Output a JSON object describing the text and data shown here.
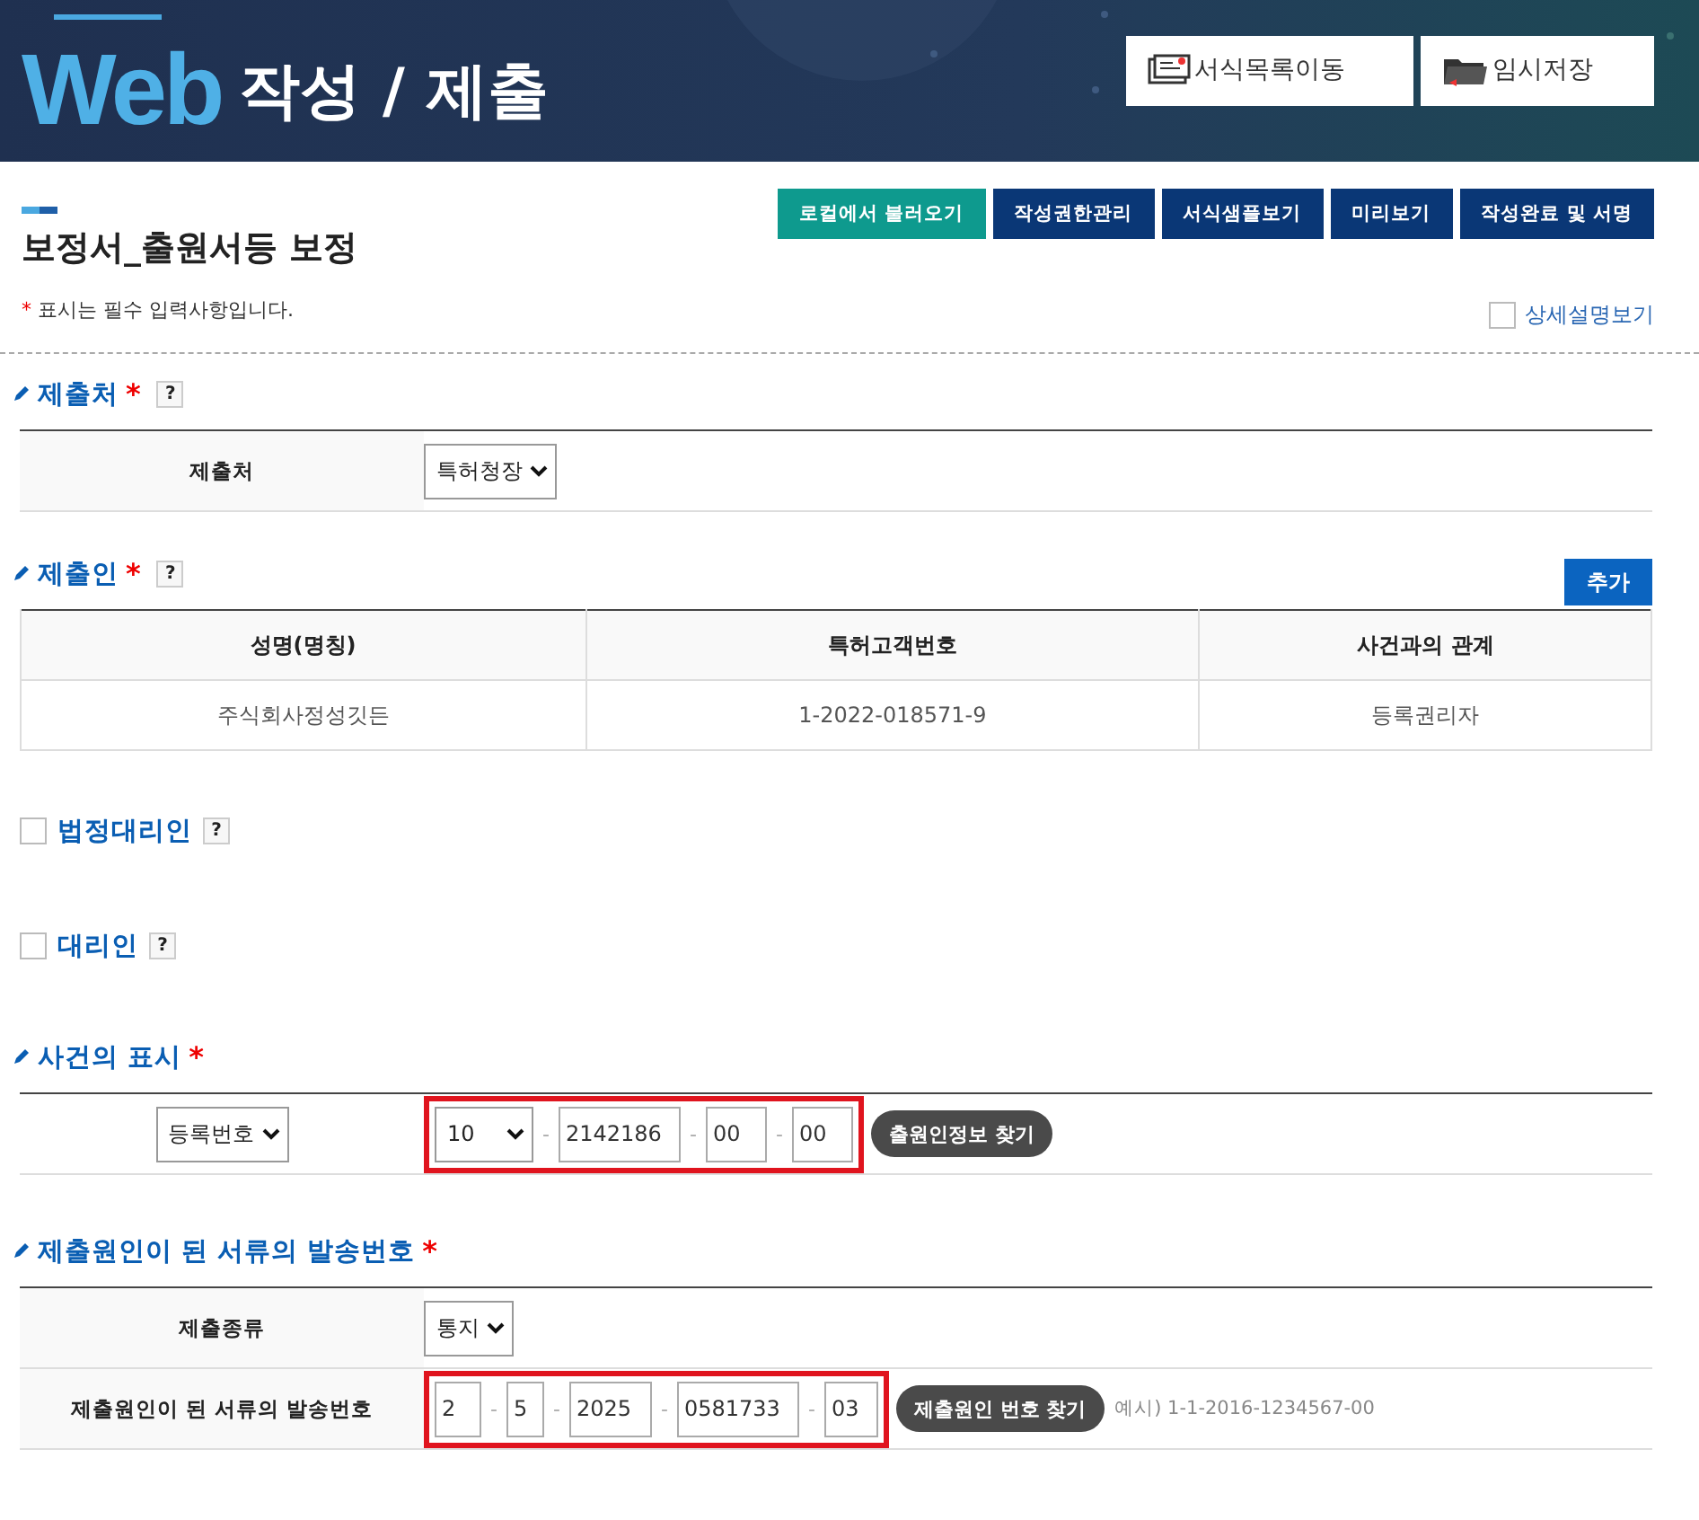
{
  "header": {
    "logo": "Web",
    "title": "작성 / 제출",
    "buttons": [
      {
        "label": "서식목록이동"
      },
      {
        "label": "임시저장"
      }
    ]
  },
  "toolbar": [
    {
      "label": "로컬에서 불러오기",
      "kind": "accent"
    },
    {
      "label": "작성권한관리",
      "kind": "normal"
    },
    {
      "label": "서식샘플보기",
      "kind": "normal"
    },
    {
      "label": "미리보기",
      "kind": "normal"
    },
    {
      "label": "작성완료 및 서명",
      "kind": "normal"
    }
  ],
  "form_title": "보정서_출원서등 보정",
  "required_note": {
    "mark": "*",
    "text": "표시는 필수 입력사항입니다."
  },
  "detail_toggle": {
    "label": "상세설명보기",
    "checked": false
  },
  "sections": [
    {
      "kind": "form",
      "title": "제출처",
      "required": true,
      "help": "?",
      "rows": [
        {
          "label": "제출처",
          "select": "특허청장"
        }
      ]
    },
    {
      "kind": "grid",
      "title": "제출인",
      "required": true,
      "help": "?",
      "add_button": "추가",
      "columns": [
        "성명(명칭)",
        "특허고객번호",
        "사건과의 관계"
      ],
      "rows": [
        [
          "주식회사정성깃든",
          "1-2022-018571-9",
          "등록권리자"
        ]
      ]
    },
    {
      "kind": "check",
      "title": "법정대리인",
      "checked": false,
      "help": "?"
    },
    {
      "kind": "check",
      "title": "대리인",
      "checked": false,
      "help": "?"
    },
    {
      "kind": "form",
      "title": "사건의 표시",
      "required": true,
      "rows": [
        {
          "label_select": "등록번호",
          "number": {
            "highlighted": true,
            "separator": "-",
            "parts": [
              {
                "kind": "select",
                "value": "10"
              },
              {
                "kind": "input",
                "value": "2142186"
              },
              {
                "kind": "input",
                "value": "00"
              },
              {
                "kind": "input",
                "value": "00"
              }
            ]
          },
          "find_button": "출원인정보 찾기"
        }
      ]
    },
    {
      "kind": "form",
      "title": "제출원인이 된 서류의 발송번호",
      "required": true,
      "rows": [
        {
          "label": "제출종류",
          "select": "통지"
        },
        {
          "label": "제출원인이 된 서류의 발송번호",
          "number": {
            "highlighted": true,
            "separator": "-",
            "parts": [
              {
                "kind": "input",
                "value": "2"
              },
              {
                "kind": "input",
                "value": "5"
              },
              {
                "kind": "input",
                "value": "2025"
              },
              {
                "kind": "input",
                "value": "0581733"
              },
              {
                "kind": "input",
                "value": "03"
              }
            ]
          },
          "find_button": "제출원인 번호 찾기",
          "example": "예시) 1-1-2016-1234567-00"
        }
      ]
    }
  ]
}
